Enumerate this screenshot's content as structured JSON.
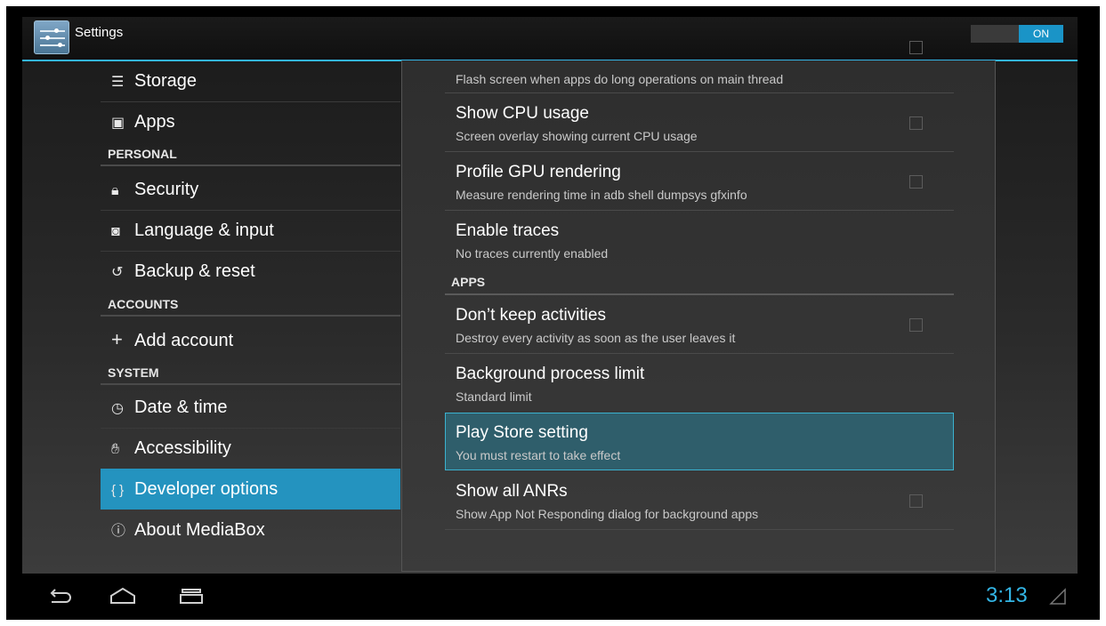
{
  "action_bar": {
    "title": "Settings",
    "toggle_label": "ON",
    "accent": "#33b5e5"
  },
  "left_nav": {
    "selected_color": "#2493bf",
    "items": [
      {
        "label": "Storage",
        "icon": "storage-icon"
      },
      {
        "label": "Apps",
        "icon": "apps-icon"
      },
      {
        "label": "Security",
        "icon": "lock-icon"
      },
      {
        "label": "Language & input",
        "icon": "keyboard-icon"
      },
      {
        "label": "Backup & reset",
        "icon": "backup-icon"
      },
      {
        "label": "Add account",
        "icon": "plus-icon"
      },
      {
        "label": "Date & time",
        "icon": "clock-icon"
      },
      {
        "label": "Accessibility",
        "icon": "hand-icon"
      },
      {
        "label": "Developer options",
        "icon": "braces-icon",
        "selected": true
      },
      {
        "label": "About MediaBox",
        "icon": "info-icon"
      }
    ],
    "headers": [
      "PERSONAL",
      "ACCOUNTS",
      "SYSTEM"
    ]
  },
  "prefs": {
    "strict_mode_summary": "Flash screen when apps do long operations on main thread",
    "items": [
      {
        "title": "Show CPU usage",
        "summary": "Screen overlay showing current CPU usage",
        "checkbox": true,
        "checked": false
      },
      {
        "title": "Profile GPU rendering",
        "summary": "Measure rendering time in adb shell dumpsys gfxinfo",
        "checkbox": true,
        "checked": false
      },
      {
        "title": "Enable traces",
        "summary": "No traces currently enabled",
        "checkbox": false
      },
      {
        "title": "Don’t keep activities",
        "summary": "Destroy every activity as soon as the user leaves it",
        "checkbox": true,
        "checked": false
      },
      {
        "title": "Background process limit",
        "summary": "Standard limit",
        "checkbox": false
      },
      {
        "title": "Play Store setting",
        "summary": "You must restart to take effect",
        "checkbox": false,
        "selected": true
      },
      {
        "title": "Show all ANRs",
        "summary": "Show App Not Responding dialog for background apps",
        "checkbox": true,
        "checked": false
      }
    ],
    "apps_header": "APPS"
  },
  "system_bar": {
    "clock": "3:13",
    "buttons": [
      "back-icon",
      "home-icon",
      "recents-icon"
    ]
  }
}
